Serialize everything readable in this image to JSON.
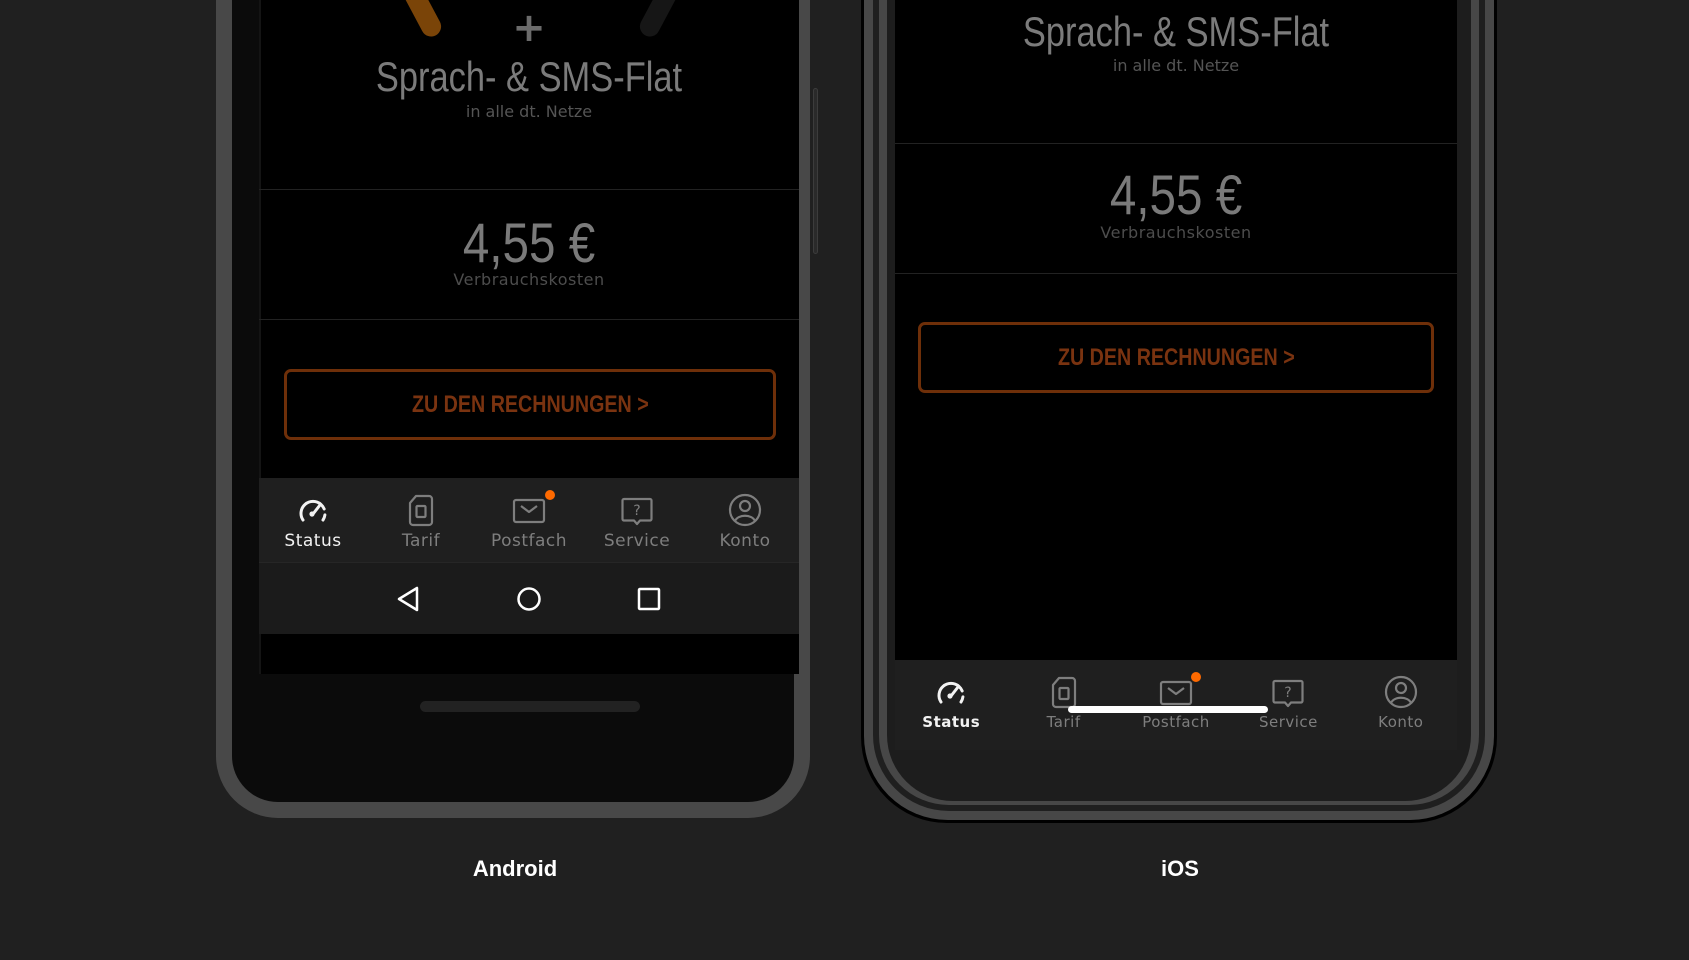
{
  "plan": {
    "plus_symbol": "+",
    "title": "Sprach- & SMS-Flat",
    "subtitle": "in alle dt. Netze"
  },
  "costs": {
    "amount": "4,55 €",
    "label": "Verbrauchskosten"
  },
  "cta": {
    "label": "ZU DEN RECHNUNGEN >"
  },
  "tabbar": {
    "items": [
      {
        "label": "Status",
        "icon": "speedometer-icon",
        "active": true
      },
      {
        "label": "Tarif",
        "icon": "sim-card-icon",
        "active": false
      },
      {
        "label": "Postfach",
        "icon": "mail-icon",
        "active": false,
        "badge": true
      },
      {
        "label": "Service",
        "icon": "help-bubble-icon",
        "active": false
      },
      {
        "label": "Konto",
        "icon": "user-circle-icon",
        "active": false
      }
    ]
  },
  "android_nav": {
    "back": "back-triangle-icon",
    "home": "home-circle-icon",
    "recents": "recents-square-icon"
  },
  "captions": {
    "android": "Android",
    "ios": "iOS"
  },
  "colors": {
    "accent": "#ff6a00",
    "cta_border": "#6e2f09",
    "cta_text": "#7a3310",
    "gauge_fill": "#7a4408",
    "background": "#202020"
  }
}
